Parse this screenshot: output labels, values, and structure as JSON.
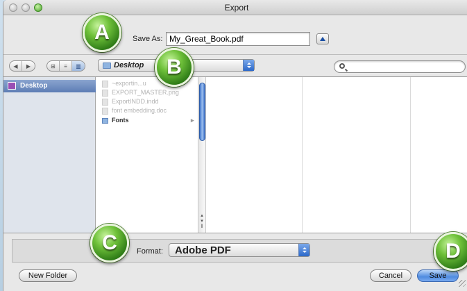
{
  "window": {
    "title": "Export"
  },
  "save_as": {
    "label": "Save As:",
    "value": "My_Great_Book.pdf"
  },
  "toolbar": {
    "nav_back": "◀",
    "nav_forward": "▶",
    "view_icons": "⊞",
    "view_list": "≡",
    "view_columns": "▥",
    "location": "Desktop",
    "search_placeholder": ""
  },
  "sidebar": {
    "items": [
      {
        "label": "Desktop",
        "icon": "desktop-icon"
      }
    ]
  },
  "files": [
    {
      "name": "~exportin...u",
      "type": "file"
    },
    {
      "name": "EXPORT_MASTER.png",
      "type": "file"
    },
    {
      "name": "ExportINDD.indd",
      "type": "file"
    },
    {
      "name": "font embedding.doc",
      "type": "file"
    },
    {
      "name": "Fonts",
      "type": "folder"
    }
  ],
  "format": {
    "label": "Format:",
    "value": "Adobe PDF"
  },
  "buttons": {
    "new_folder": "New Folder",
    "cancel": "Cancel",
    "save": "Save"
  },
  "callouts": [
    "A",
    "B",
    "C",
    "D"
  ],
  "colors": {
    "accent": "#4f8be0",
    "callout": "#4aa22b",
    "sidebar_selection": "#6f8ec2"
  }
}
